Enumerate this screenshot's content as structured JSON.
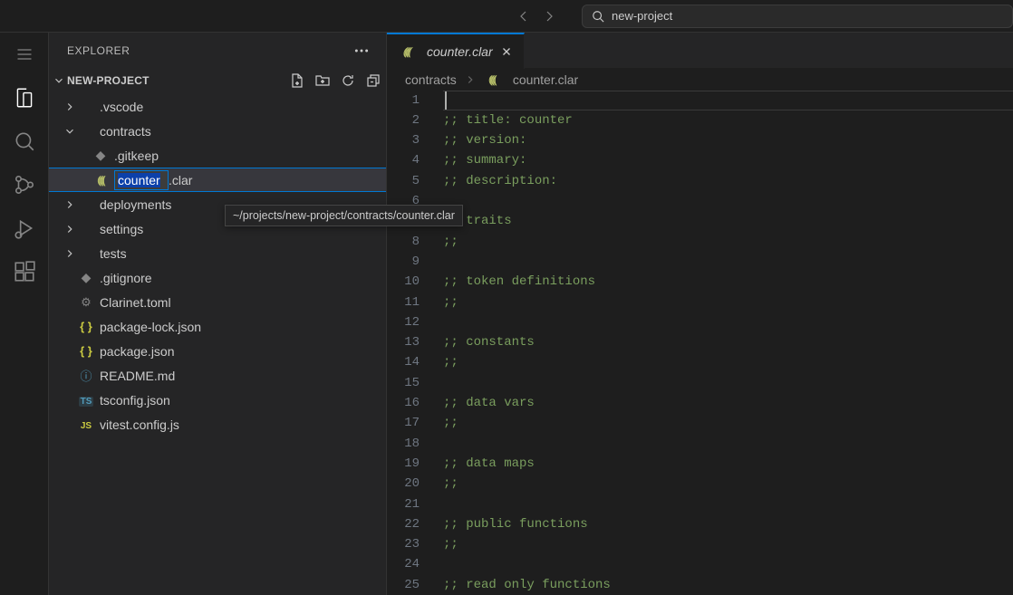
{
  "titlebar": {
    "search_value": "new-project"
  },
  "sidebar": {
    "title": "EXPLORER",
    "project_name": "NEW-PROJECT",
    "rename_value": "counter",
    "rename_suffix": ".clar",
    "tree": [
      {
        "label": ".vscode",
        "type": "folder",
        "indent": 1
      },
      {
        "label": "contracts",
        "type": "folder",
        "indent": 1,
        "expanded": true
      },
      {
        "label": ".gitkeep",
        "type": "git",
        "indent": 2
      },
      {
        "label": "counter.clar",
        "type": "clar",
        "indent": 2,
        "renaming": true
      },
      {
        "label": "deployments",
        "type": "folder",
        "indent": 1
      },
      {
        "label": "settings",
        "type": "folder",
        "indent": 1
      },
      {
        "label": "tests",
        "type": "folder",
        "indent": 1
      },
      {
        "label": ".gitignore",
        "type": "git",
        "indent": 1
      },
      {
        "label": "Clarinet.toml",
        "type": "gear",
        "indent": 1
      },
      {
        "label": "package-lock.json",
        "type": "json",
        "indent": 1
      },
      {
        "label": "package.json",
        "type": "json",
        "indent": 1
      },
      {
        "label": "README.md",
        "type": "readme",
        "indent": 1
      },
      {
        "label": "tsconfig.json",
        "type": "ts",
        "indent": 1
      },
      {
        "label": "vitest.config.js",
        "type": "js",
        "indent": 1
      }
    ]
  },
  "tab": {
    "filename": "counter.clar"
  },
  "breadcrumb": {
    "folder": "contracts",
    "file": "counter.clar"
  },
  "tooltip": "~/projects/new-project/contracts/counter.clar",
  "editor": {
    "lines": [
      "",
      ";; title: counter",
      ";; version:",
      ";; summary:",
      ";; description:",
      "",
      ";; traits",
      ";;",
      "",
      ";; token definitions",
      ";;",
      "",
      ";; constants",
      ";;",
      "",
      ";; data vars",
      ";;",
      "",
      ";; data maps",
      ";;",
      "",
      ";; public functions",
      ";;",
      "",
      ";; read only functions"
    ]
  }
}
